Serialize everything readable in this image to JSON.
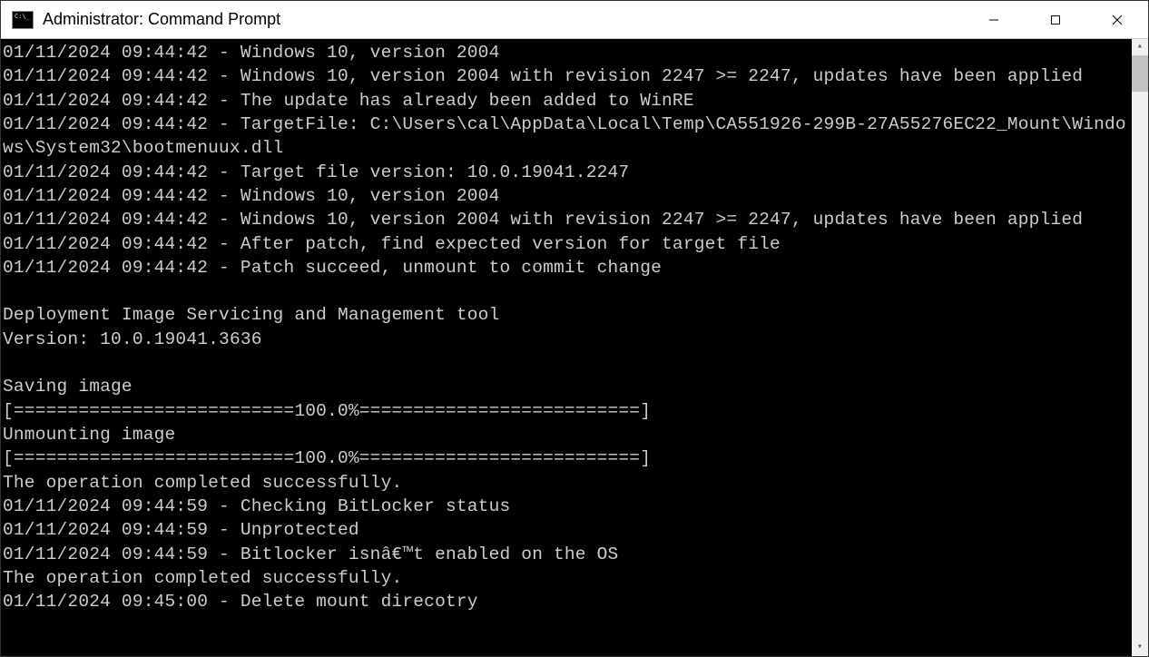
{
  "window": {
    "title": "Administrator: Command Prompt"
  },
  "console": {
    "lines": [
      "01/11/2024 09:44:42 - Windows 10, version 2004",
      "01/11/2024 09:44:42 - Windows 10, version 2004 with revision 2247 >= 2247, updates have been applied",
      "01/11/2024 09:44:42 - The update has already been added to WinRE",
      "01/11/2024 09:44:42 - TargetFile: C:\\Users\\cal\\AppData\\Local\\Temp\\CA551926-299B-27A55276EC22_Mount\\Windows\\System32\\bootmenuux.dll",
      "01/11/2024 09:44:42 - Target file version: 10.0.19041.2247",
      "01/11/2024 09:44:42 - Windows 10, version 2004",
      "01/11/2024 09:44:42 - Windows 10, version 2004 with revision 2247 >= 2247, updates have been applied",
      "01/11/2024 09:44:42 - After patch, find expected version for target file",
      "01/11/2024 09:44:42 - Patch succeed, unmount to commit change",
      "",
      "Deployment Image Servicing and Management tool",
      "Version: 10.0.19041.3636",
      "",
      "Saving image",
      "[==========================100.0%==========================]",
      "Unmounting image",
      "[==========================100.0%==========================]",
      "The operation completed successfully.",
      "01/11/2024 09:44:59 - Checking BitLocker status",
      "01/11/2024 09:44:59 - Unprotected",
      "01/11/2024 09:44:59 - Bitlocker isnâ€™t enabled on the OS",
      "The operation completed successfully.",
      "01/11/2024 09:45:00 - Delete mount direcotry"
    ]
  }
}
